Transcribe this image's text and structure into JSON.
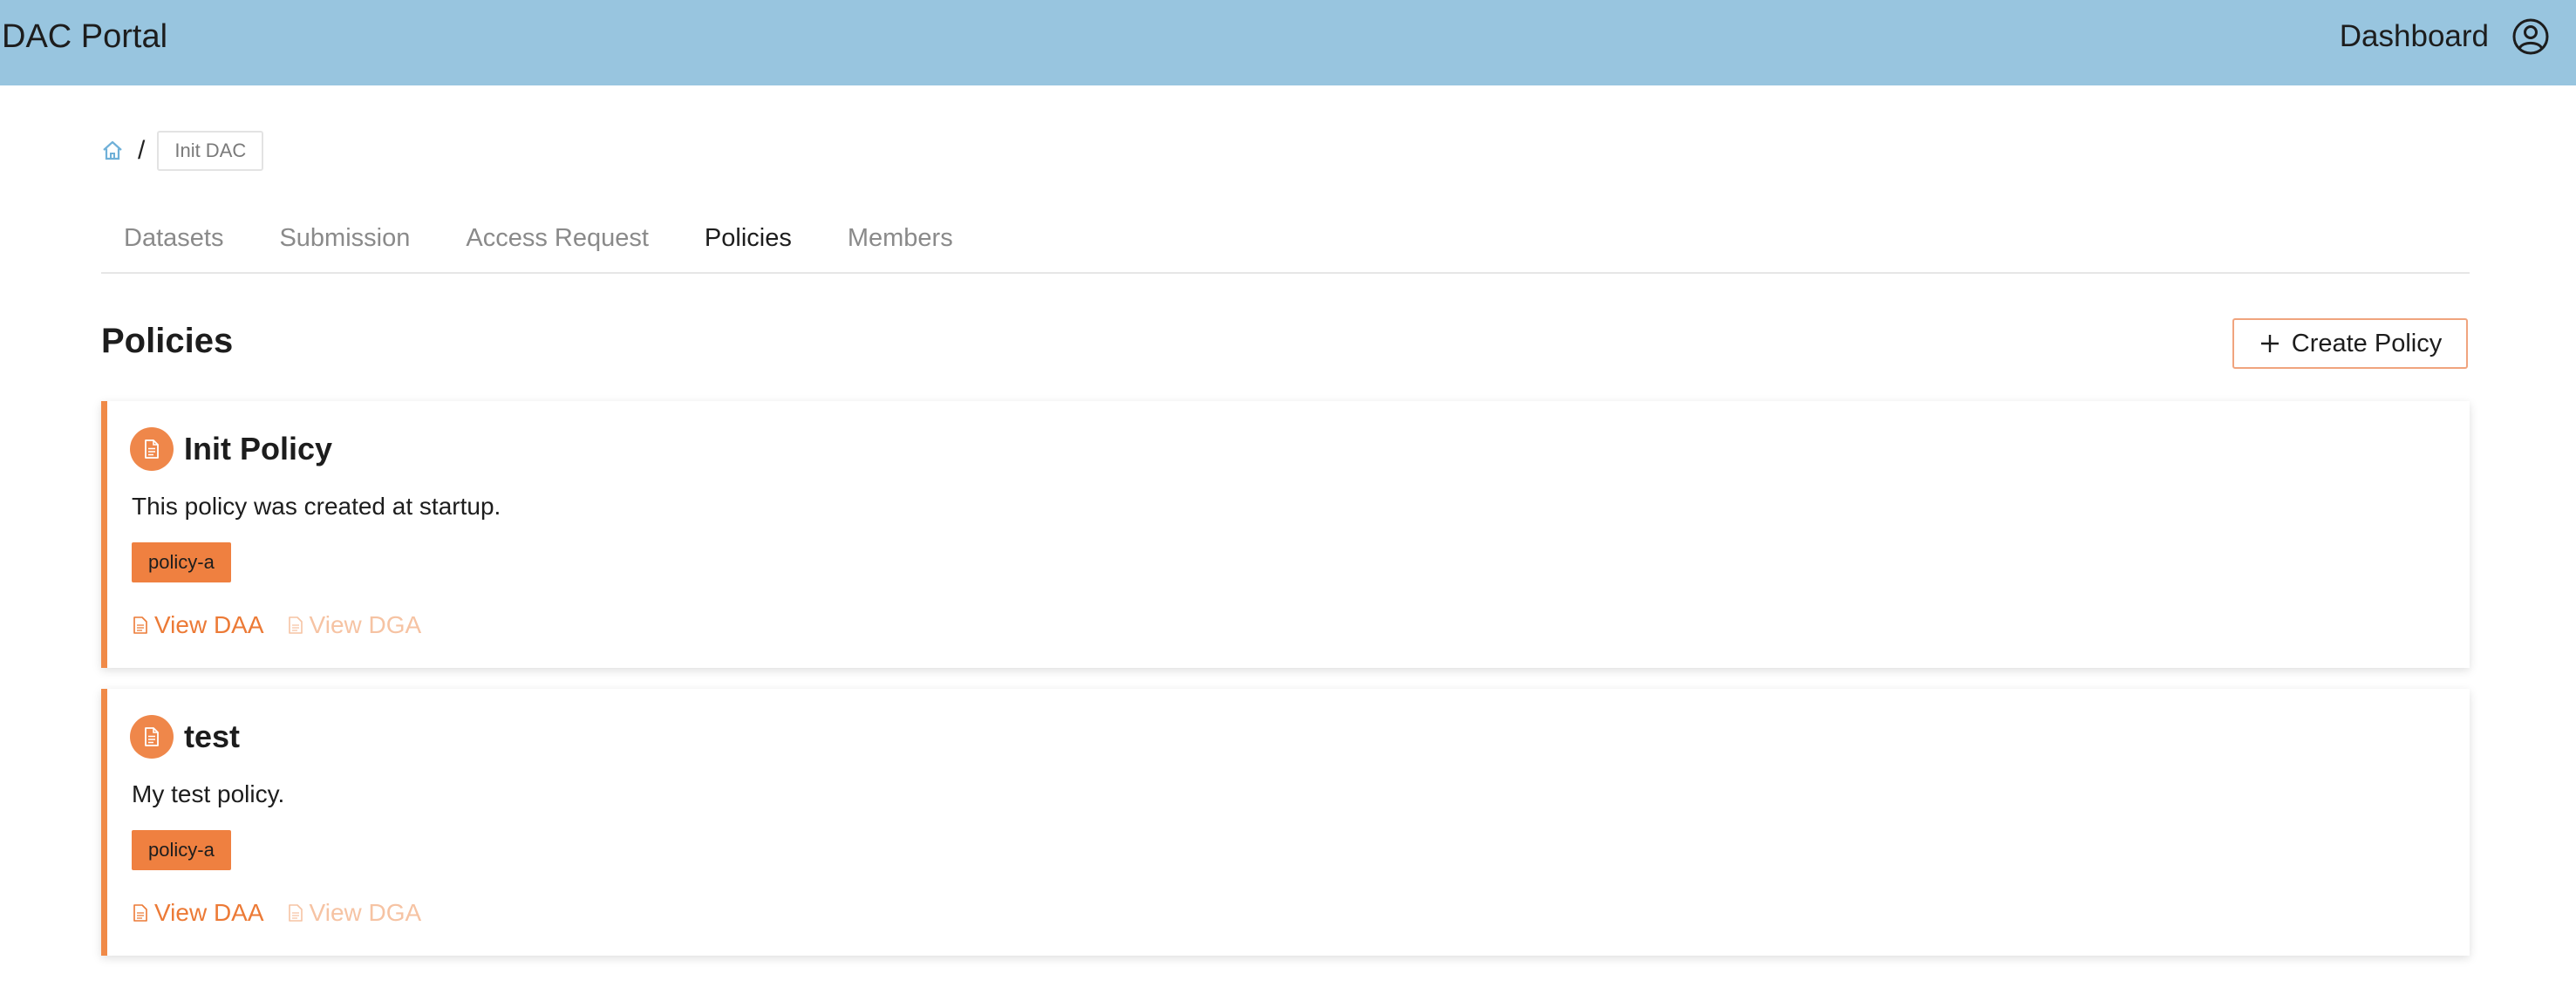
{
  "app": {
    "title": "DAC Portal"
  },
  "header": {
    "dashboard_label": "Dashboard",
    "user_icon": "user-circle-icon"
  },
  "breadcrumb": {
    "home_icon": "home-icon",
    "separator": "/",
    "current": "Init DAC"
  },
  "tabs": [
    {
      "label": "Datasets",
      "active": false
    },
    {
      "label": "Submission",
      "active": false
    },
    {
      "label": "Access Request",
      "active": false
    },
    {
      "label": "Policies",
      "active": true
    },
    {
      "label": "Members",
      "active": false
    }
  ],
  "section": {
    "title": "Policies",
    "create_button_label": "Create Policy"
  },
  "policies": [
    {
      "title": "Init Policy",
      "description": "This policy was created at startup.",
      "tag": "policy-a",
      "view_daa_label": "View DAA",
      "view_dga_label": "View DGA"
    },
    {
      "title": "test",
      "description": "My test policy.",
      "tag": "policy-a",
      "view_daa_label": "View DAA",
      "view_dga_label": "View DGA"
    }
  ],
  "colors": {
    "header_bg": "#98c5df",
    "accent": "#ef874a",
    "link_active": "#ec7a36",
    "link_disabled": "#f6c3a3"
  }
}
